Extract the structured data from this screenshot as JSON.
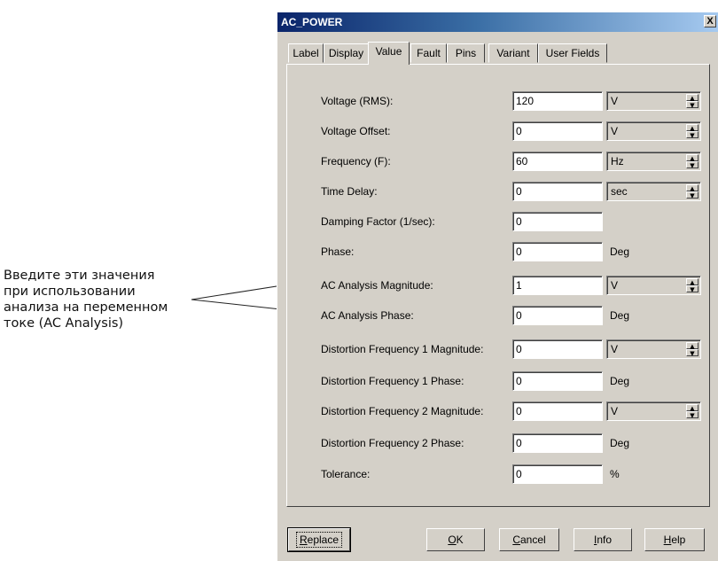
{
  "annotation": {
    "lines": [
      "Введите эти значения",
      "при использовании",
      "анализа на переменном",
      "токе (AC Analysis)"
    ]
  },
  "dialog": {
    "title": "AC_POWER",
    "close_label": "X",
    "tabs": [
      {
        "label": "Label",
        "active": false
      },
      {
        "label": "Display",
        "active": false
      },
      {
        "label": "Value",
        "active": true
      },
      {
        "label": "Fault",
        "active": false
      },
      {
        "label": "Pins",
        "active": false
      },
      {
        "label": "Variant",
        "active": false
      },
      {
        "label": "User Fields",
        "active": false
      }
    ],
    "fields": [
      {
        "label": "Voltage (RMS):",
        "value": "120",
        "unit": "V",
        "unit_type": "select"
      },
      {
        "label": "Voltage Offset:",
        "value": "0",
        "unit": "V",
        "unit_type": "select"
      },
      {
        "label": "Frequency (F):",
        "value": "60",
        "unit": "Hz",
        "unit_type": "select"
      },
      {
        "label": "Time Delay:",
        "value": "0",
        "unit": "sec",
        "unit_type": "select"
      },
      {
        "label": "Damping Factor (1/sec):",
        "value": "0",
        "unit": "",
        "unit_type": "none"
      },
      {
        "label": "Phase:",
        "value": "0",
        "unit": "Deg",
        "unit_type": "text"
      },
      {
        "label": "AC Analysis Magnitude:",
        "value": "1",
        "unit": "V",
        "unit_type": "select"
      },
      {
        "label": "AC Analysis Phase:",
        "value": "0",
        "unit": "Deg",
        "unit_type": "text"
      },
      {
        "label": "Distortion Frequency 1 Magnitude:",
        "value": "0",
        "unit": "V",
        "unit_type": "select"
      },
      {
        "label": "Distortion Frequency 1 Phase:",
        "value": "0",
        "unit": "Deg",
        "unit_type": "text"
      },
      {
        "label": "Distortion Frequency 2 Magnitude:",
        "value": "0",
        "unit": "V",
        "unit_type": "select"
      },
      {
        "label": "Distortion Frequency 2 Phase:",
        "value": "0",
        "unit": "Deg",
        "unit_type": "text"
      },
      {
        "label": "Tolerance:",
        "value": "0",
        "unit": "%",
        "unit_type": "text"
      }
    ],
    "buttons": {
      "replace": {
        "first": "R",
        "rest": "eplace"
      },
      "ok": {
        "first": "O",
        "rest": "K"
      },
      "cancel": {
        "first": "C",
        "rest": "ancel"
      },
      "info": {
        "first": "I",
        "rest": "nfo"
      },
      "help": {
        "first": "H",
        "rest": "elp"
      }
    }
  }
}
